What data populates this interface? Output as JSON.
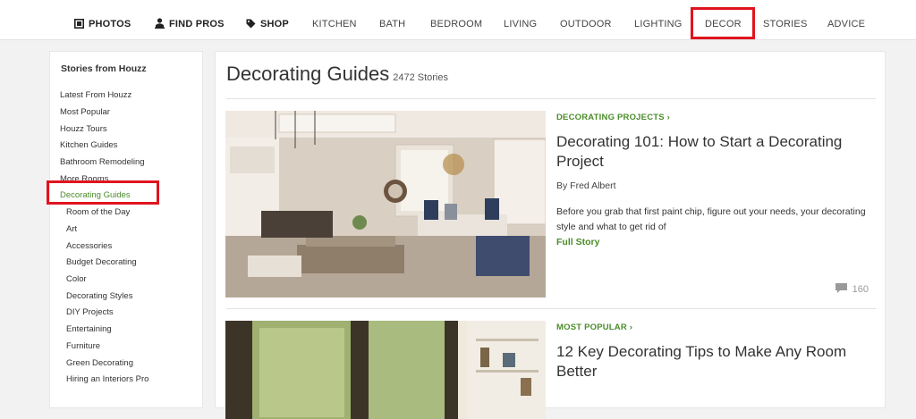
{
  "nav": {
    "items": [
      {
        "label": "PHOTOS",
        "icon": "photos-icon"
      },
      {
        "label": "FIND PROS",
        "icon": "person-icon"
      },
      {
        "label": "SHOP",
        "icon": "tag-icon"
      },
      {
        "label": "KITCHEN"
      },
      {
        "label": "BATH"
      },
      {
        "label": "BEDROOM"
      },
      {
        "label": "LIVING"
      },
      {
        "label": "OUTDOOR"
      },
      {
        "label": "LIGHTING"
      },
      {
        "label": "DECOR"
      },
      {
        "label": "STORIES"
      },
      {
        "label": "ADVICE"
      }
    ],
    "highlighted": "DECOR"
  },
  "sidebar": {
    "title": "Stories from Houzz",
    "items": [
      "Latest From Houzz",
      "Most Popular",
      "Houzz Tours",
      "Kitchen Guides",
      "Bathroom Remodeling",
      "More Rooms",
      "Decorating Guides"
    ],
    "subitems": [
      "Room of the Day",
      "Art",
      "Accessories",
      "Budget Decorating",
      "Color",
      "Decorating Styles",
      "DIY Projects",
      "Entertaining",
      "Furniture",
      "Green Decorating",
      "Hiring an Interiors Pro"
    ],
    "active": "Decorating Guides"
  },
  "main": {
    "title": "Decorating Guides",
    "count": "2472 Stories",
    "stories": [
      {
        "category": "DECORATING PROJECTS",
        "title": "Decorating 101: How to Start a Decorating Project",
        "byline": "By Fred Albert",
        "summary": "Before you grab that first paint chip, figure out your needs, your decorating style and what to get rid of",
        "cta": "Full Story",
        "comments": "160"
      },
      {
        "category": "MOST POPULAR",
        "title": "12 Key Decorating Tips to Make Any Room Better"
      }
    ]
  },
  "colors": {
    "accent_green": "#4b8c2a",
    "highlight_red": "#e0141e"
  }
}
